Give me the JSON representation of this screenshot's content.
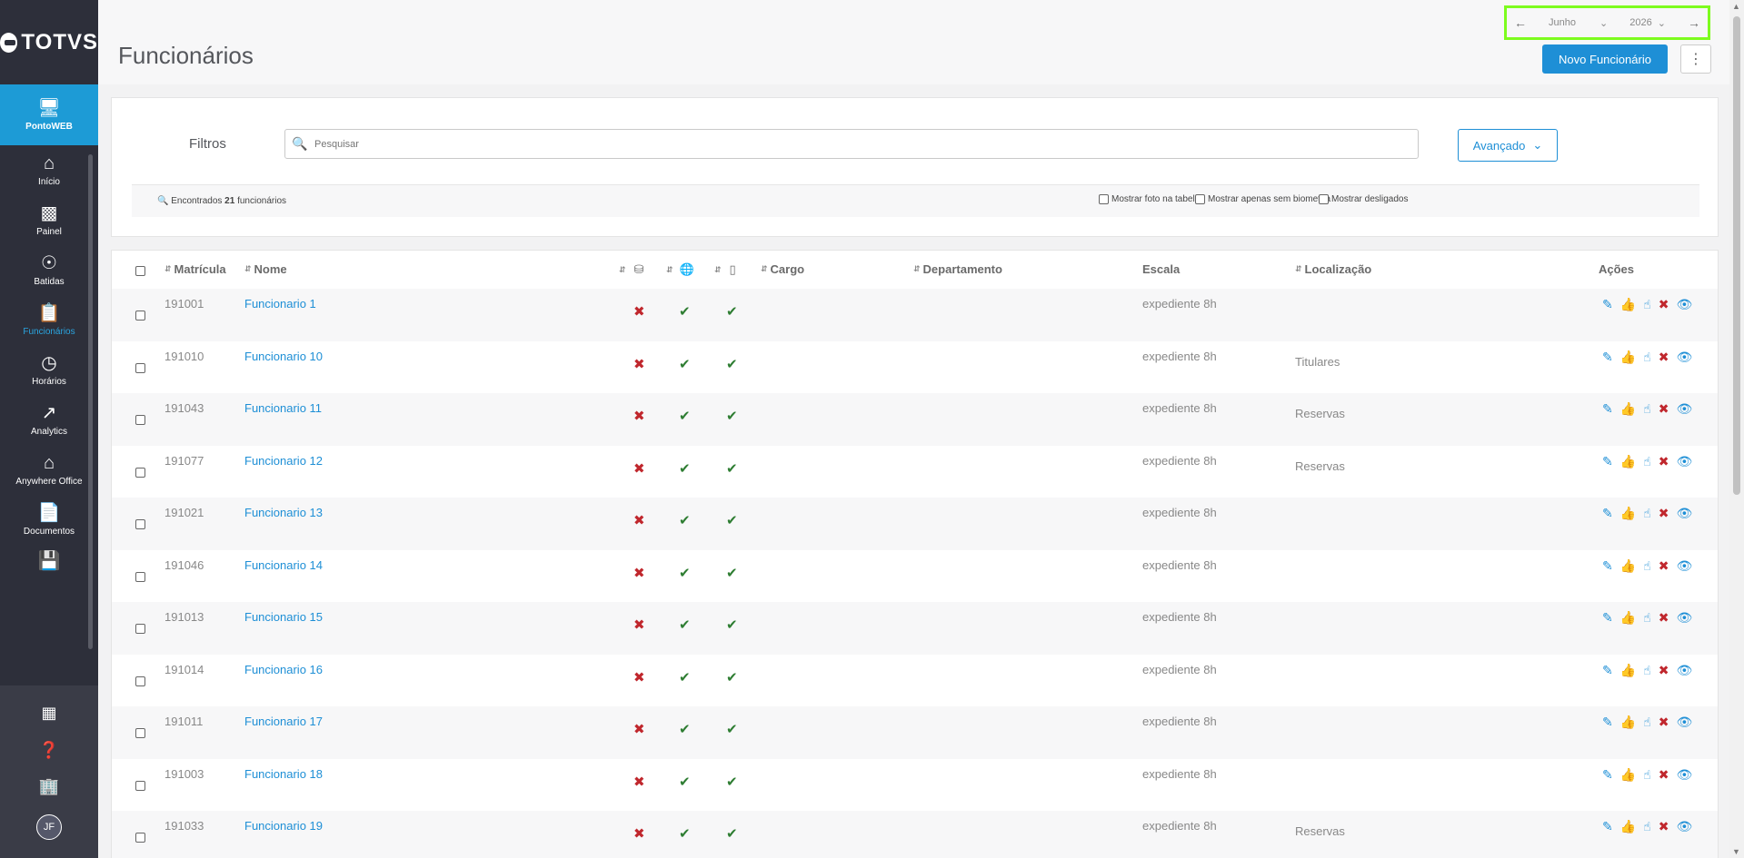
{
  "brand": {
    "logo_text": "TOTVS"
  },
  "sidebar": {
    "top": {
      "label": "PontoWEB",
      "icon": "monitor-icon"
    },
    "items": [
      {
        "label": "Início",
        "icon": "home-icon"
      },
      {
        "label": "Painel",
        "icon": "dashboard-icon"
      },
      {
        "label": "Batidas",
        "icon": "fingerprint-icon"
      },
      {
        "label": "Funcionários",
        "icon": "badge-icon",
        "active": true
      },
      {
        "label": "Horários",
        "icon": "clock-icon"
      },
      {
        "label": "Analytics",
        "icon": "trend-icon"
      },
      {
        "label": "Anywhere Office",
        "icon": "house-office-icon"
      },
      {
        "label": "Documentos",
        "icon": "document-icon"
      }
    ],
    "avatar_initials": "JF"
  },
  "header": {
    "title": "Funcionários",
    "month": "Junho",
    "year": "2026",
    "new_button": "Novo Funcionário"
  },
  "filters": {
    "label": "Filtros",
    "search_placeholder": "Pesquisar",
    "advanced_button": "Avançado",
    "found_prefix": "Encontrados",
    "found_count": "21",
    "found_suffix": "funcionários",
    "options": [
      "Mostrar foto na tabela",
      "Mostrar apenas sem biometria",
      "Mostrar desligados"
    ]
  },
  "table": {
    "columns": {
      "matricula": "Matrícula",
      "nome": "Nome",
      "cargo": "Cargo",
      "departamento": "Departamento",
      "escala": "Escala",
      "localizacao": "Localização",
      "acoes": "Ações"
    },
    "rows": [
      {
        "matricula": "191001",
        "nome": "Funcionario 1",
        "escala": "expediente 8h",
        "localizacao": ""
      },
      {
        "matricula": "191010",
        "nome": "Funcionario 10",
        "escala": "expediente 8h",
        "localizacao": "Titulares"
      },
      {
        "matricula": "191043",
        "nome": "Funcionario 11",
        "escala": "expediente 8h",
        "localizacao": "Reservas"
      },
      {
        "matricula": "191077",
        "nome": "Funcionario 12",
        "escala": "expediente 8h",
        "localizacao": "Reservas"
      },
      {
        "matricula": "191021",
        "nome": "Funcionario 13",
        "escala": "expediente 8h",
        "localizacao": ""
      },
      {
        "matricula": "191046",
        "nome": "Funcionario 14",
        "escala": "expediente 8h",
        "localizacao": ""
      },
      {
        "matricula": "191013",
        "nome": "Funcionario 15",
        "escala": "expediente 8h",
        "localizacao": ""
      },
      {
        "matricula": "191014",
        "nome": "Funcionario 16",
        "escala": "expediente 8h",
        "localizacao": ""
      },
      {
        "matricula": "191011",
        "nome": "Funcionario 17",
        "escala": "expediente 8h",
        "localizacao": ""
      },
      {
        "matricula": "191003",
        "nome": "Funcionario 18",
        "escala": "expediente 8h",
        "localizacao": ""
      },
      {
        "matricula": "191033",
        "nome": "Funcionario 19",
        "escala": "expediente 8h",
        "localizacao": "Reservas"
      }
    ]
  },
  "colors": {
    "accent": "#1e8fd6",
    "highlight": "#7dfc1e",
    "sidebar": "#2d2f3a"
  }
}
